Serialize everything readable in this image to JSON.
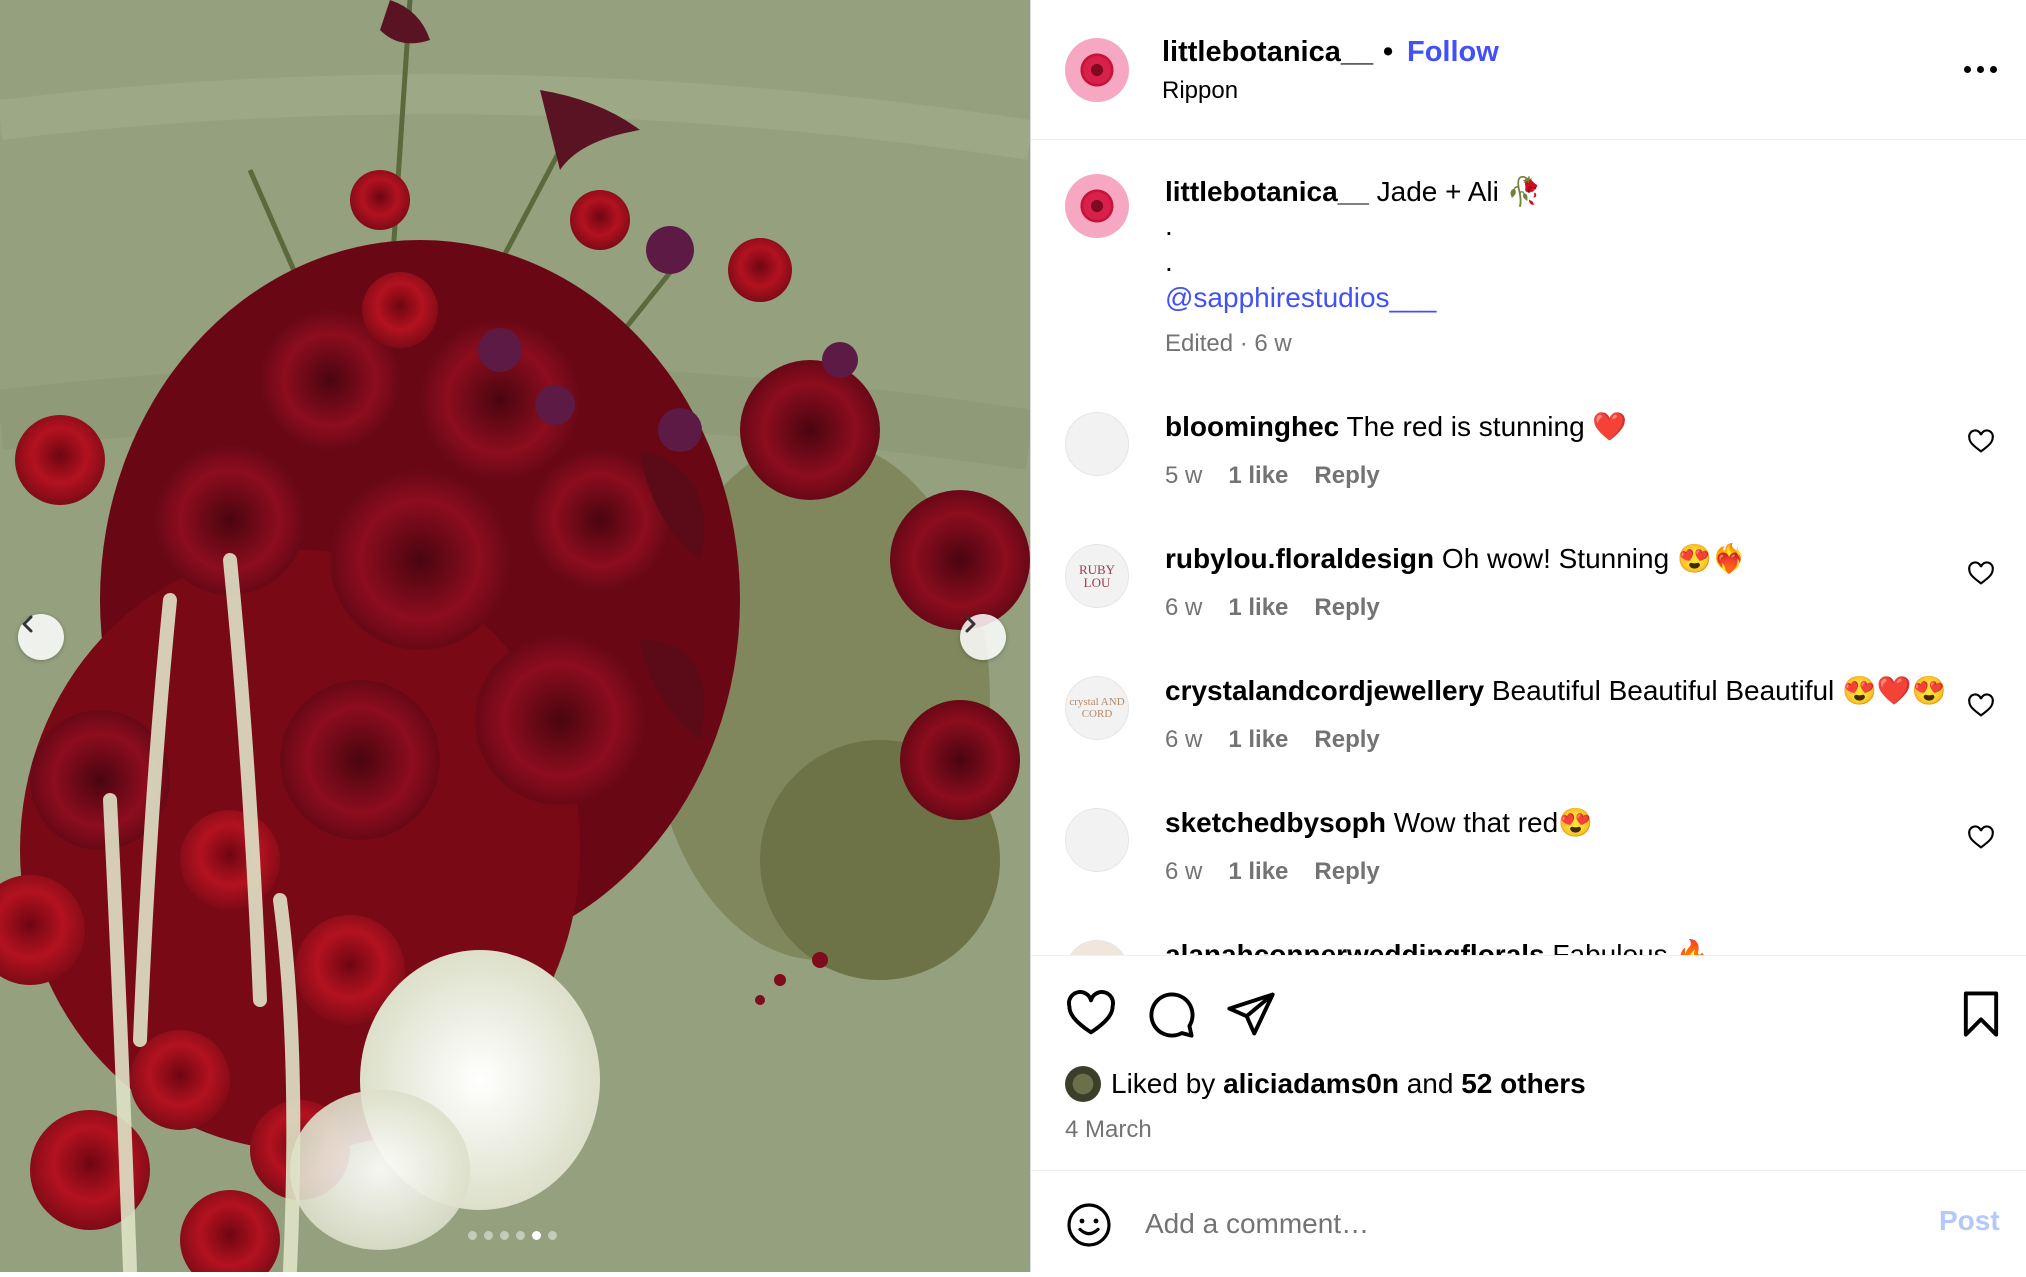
{
  "post": {
    "username": "littlebotanica__",
    "separator": "•",
    "follow_label": "Follow",
    "location": "Rippon",
    "media_dots": 6,
    "media_active_dot": 4
  },
  "caption": {
    "username": "littlebotanica__",
    "text": "Jade + Ali 🥀",
    "dot1": ".",
    "dot2": ".",
    "mention": "@sapphirestudios___",
    "meta": "Edited · 6 w"
  },
  "comments": [
    {
      "username": "bloominghec",
      "text": "The red is stunning ❤️",
      "time": "5 w",
      "likes": "1 like",
      "reply": "Reply"
    },
    {
      "username": "rubylou.floraldesign",
      "text": "Oh wow! Stunning 😍❤️‍🔥",
      "time": "6 w",
      "likes": "1 like",
      "reply": "Reply"
    },
    {
      "username": "crystalandcordjewellery",
      "text": "Beautiful Beautiful Beautiful 😍❤️😍",
      "time": "6 w",
      "likes": "1 like",
      "reply": "Reply"
    },
    {
      "username": "sketchedbysoph",
      "text": "Wow that red😍",
      "time": "6 w",
      "likes": "1 like",
      "reply": "Reply"
    },
    {
      "username": "alanahconnerweddingflorals",
      "text": "Fabulous 🔥"
    }
  ],
  "avatars": {
    "ruby": "RUBY LOU",
    "crystal": "crystal AND CORD"
  },
  "engagement": {
    "liked_by_prefix": "Liked by",
    "liked_by_user": "aliciadams0n",
    "and": "and",
    "others": "52 others",
    "date": "4 March"
  },
  "comment_box": {
    "placeholder": "Add a comment…",
    "post_label": "Post"
  },
  "colors": {
    "link_blue": "#4150f7",
    "post_disabled": "#b3c8fb",
    "muted": "#737373"
  }
}
